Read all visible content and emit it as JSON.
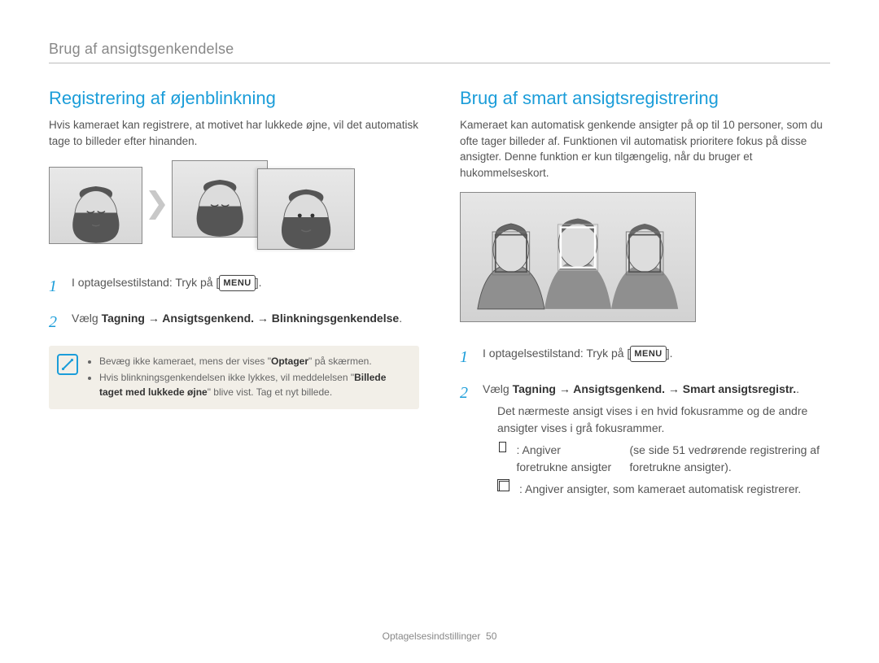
{
  "header": "Brug af ansigtsgenkendelse",
  "left": {
    "title": "Registrering af øjenblinkning",
    "intro": "Hvis kameraet kan registrere, at motivet har lukkede øjne, vil det automatisk tage to billeder efter hinanden.",
    "steps": [
      {
        "num": "1",
        "pre": "I optagelsestilstand: Tryk på [",
        "menu": "MENU",
        "post": "]."
      },
      {
        "num": "2",
        "rich_prefix": "Vælg ",
        "bold": "Tagning → Ansigtsgenkend. → Blinkningsgenkendelse",
        "suffix": "."
      }
    ],
    "note": {
      "items": [
        {
          "pre": "Bevæg ikke kameraet, mens der vises \"",
          "bold": "Optager",
          "post": "\" på skærmen."
        },
        {
          "pre": "Hvis blinkningsgenkendelsen ikke lykkes, vil meddelelsen \"",
          "bold": "Billede taget med lukkede øjne",
          "post": "\" blive vist. Tag et nyt billede."
        }
      ]
    }
  },
  "right": {
    "title": "Brug af smart ansigtsregistrering",
    "intro": "Kameraet kan automatisk genkende ansigter på op til 10 personer, som du ofte tager billeder af. Funktionen vil automatisk prioritere fokus på disse ansigter. Denne funktion er kun tilgængelig, når du bruger et hukommelseskort.",
    "steps": [
      {
        "num": "1",
        "pre": "I optagelsestilstand: Tryk på [",
        "menu": "MENU",
        "post": "]."
      },
      {
        "num": "2",
        "rich_prefix": "Vælg ",
        "bold": "Tagning → Ansigtsgenkend. → Smart ansigtsregistr.",
        "suffix": "."
      }
    ],
    "bullets": [
      "Det nærmeste ansigt vises i en hvid fokusramme og de andre ansigter vises i grå fokusrammer.",
      {
        "icon": "single",
        "text": " : Angiver foretrukne ansigter",
        "sub": "(se side 51 vedrørende registrering af foretrukne ansigter)."
      },
      {
        "icon": "double",
        "text": " : Angiver ansigter, som kameraet automatisk registrerer."
      }
    ]
  },
  "footer": {
    "section": "Optagelsesindstillinger",
    "page": "50"
  }
}
